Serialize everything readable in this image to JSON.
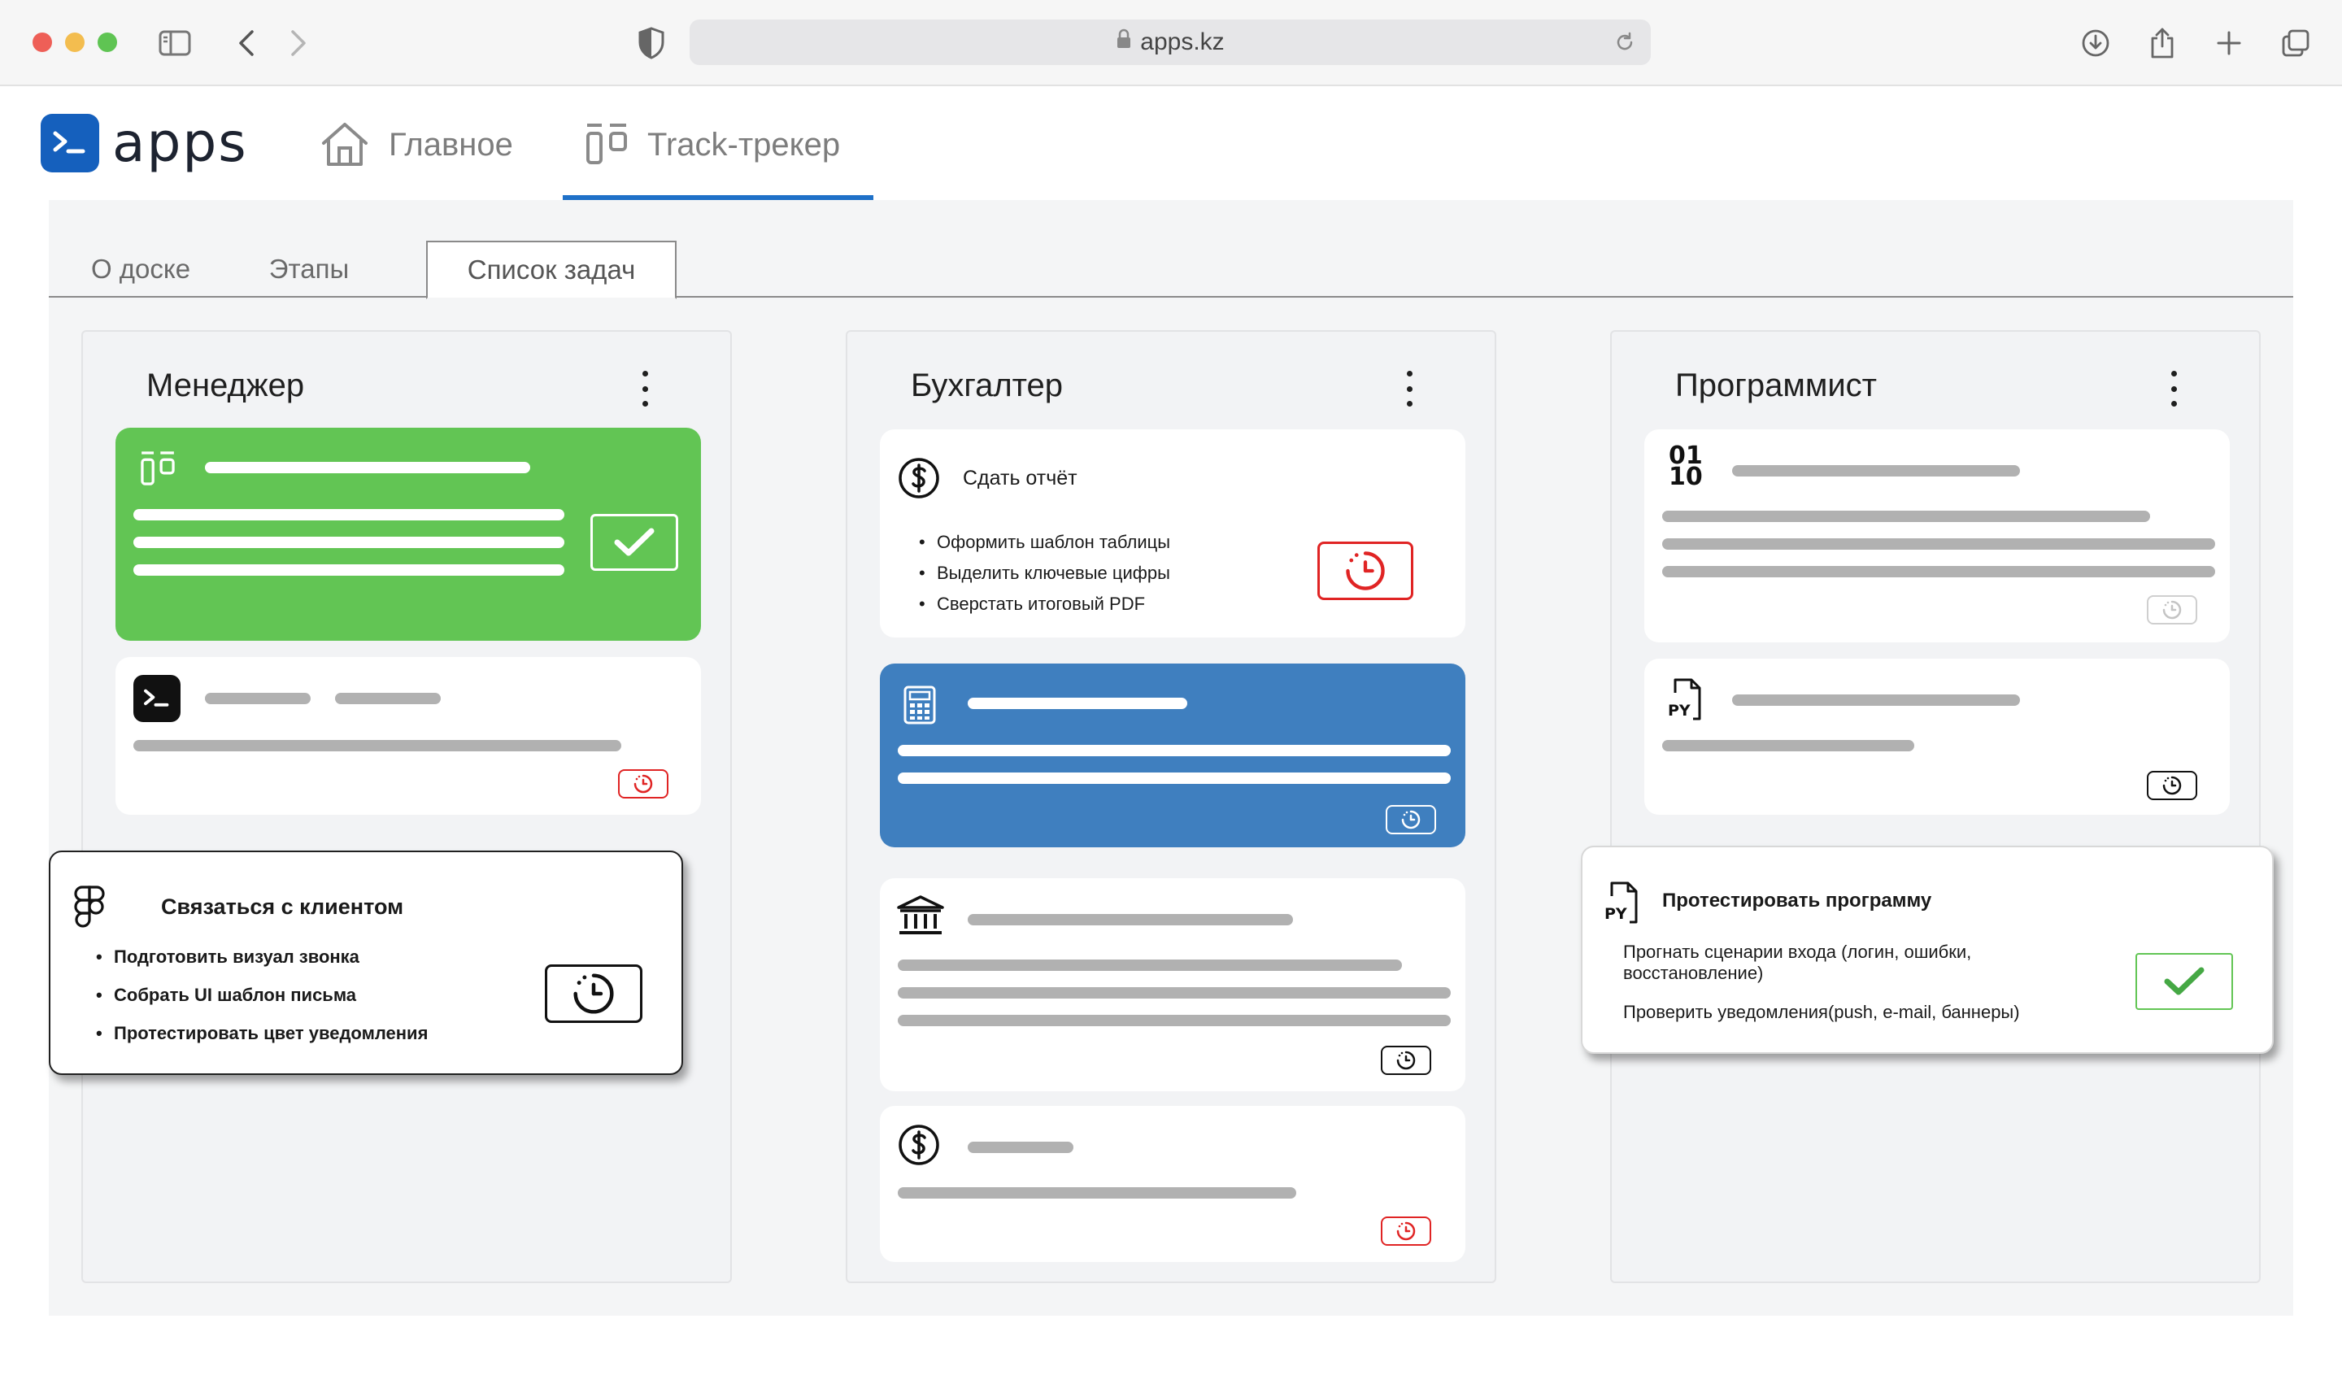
{
  "browser": {
    "url": "apps.kz",
    "icons": [
      "sidebar-icon",
      "back-icon",
      "forward-icon",
      "shield-icon",
      "lock-icon",
      "reload-icon",
      "download-icon",
      "share-icon",
      "new-tab-icon",
      "tabs-overview-icon"
    ]
  },
  "header": {
    "logo_text": "apps",
    "nav": [
      {
        "label": "Главное",
        "icon": "home-icon"
      },
      {
        "label": "Track-трекер",
        "icon": "tracker-icon",
        "active": true
      }
    ]
  },
  "tabs": [
    {
      "label": "О доске"
    },
    {
      "label": "Этапы"
    },
    {
      "label": "Список задач",
      "active": true
    }
  ],
  "columns": [
    {
      "title": "Менеджер",
      "cards": [
        {
          "state": "done",
          "color": "#62c554",
          "icon": "tracker-icon"
        },
        {
          "state": "overdue",
          "icon": "terminal-icon"
        }
      ],
      "popup": {
        "icon": "figma-icon",
        "title": "Связаться с клиентом",
        "items": [
          "Подготовить визуал звонка",
          "Собрать UI шаблон письма",
          "Протестировать цвет уведомления"
        ],
        "status_icon": "timer-icon"
      }
    },
    {
      "title": "Бухгалтер",
      "cards": [
        {
          "icon": "dollar-icon",
          "title": "Сдать отчёт",
          "items": [
            "Оформить шаблон таблицы",
            "Выделить ключевые цифры",
            "Сверстать итоговый PDF"
          ],
          "state": "overdue"
        },
        {
          "state": "in-progress",
          "color": "#3f7fbf",
          "icon": "calculator-icon"
        },
        {
          "state": "pending",
          "icon": "bank-icon"
        },
        {
          "state": "overdue",
          "icon": "dollar-icon"
        }
      ]
    },
    {
      "title": "Программист",
      "cards": [
        {
          "state": "inactive",
          "icon": "binary-icon",
          "icon_text_top": "01",
          "icon_text_bottom": "10"
        },
        {
          "state": "pending",
          "icon": "python-file-icon",
          "icon_text": "PY"
        }
      ],
      "popup": {
        "icon": "python-file-icon",
        "icon_text": "PY",
        "title": "Протестировать программу",
        "lines": [
          "Прогнать сценарии входа (логин, ошибки, восстановление)",
          "Проверить уведомления(push, e-mail, баннеры)"
        ],
        "status_icon": "check-icon"
      }
    }
  ],
  "colors": {
    "accent": "#1f71c8",
    "done": "#62c554",
    "in_progress": "#3f7fbf",
    "overdue": "#e02424"
  }
}
